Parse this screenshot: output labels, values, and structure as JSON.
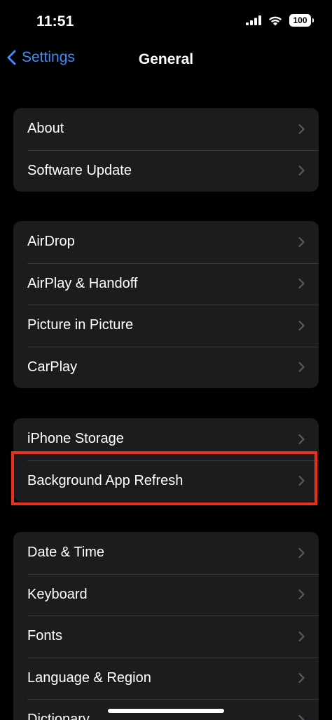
{
  "status_bar": {
    "time": "11:51",
    "battery": "100",
    "icons": [
      "signal-icon",
      "wifi-icon",
      "battery-icon"
    ]
  },
  "nav": {
    "back_label": "Settings",
    "title": "General"
  },
  "groups": [
    {
      "items": [
        {
          "label": "About"
        },
        {
          "label": "Software Update"
        }
      ]
    },
    {
      "items": [
        {
          "label": "AirDrop"
        },
        {
          "label": "AirPlay & Handoff"
        },
        {
          "label": "Picture in Picture"
        },
        {
          "label": "CarPlay"
        }
      ]
    },
    {
      "items": [
        {
          "label": "iPhone Storage"
        },
        {
          "label": "Background App Refresh"
        }
      ]
    },
    {
      "items": [
        {
          "label": "Date & Time"
        },
        {
          "label": "Keyboard"
        },
        {
          "label": "Fonts"
        },
        {
          "label": "Language & Region"
        },
        {
          "label": "Dictionary"
        }
      ]
    }
  ],
  "colors": {
    "background": "#000000",
    "cell": "#1c1c1e",
    "accent": "#3b8df7",
    "highlight": "#e8311d",
    "chevron": "#5a5a5e"
  }
}
